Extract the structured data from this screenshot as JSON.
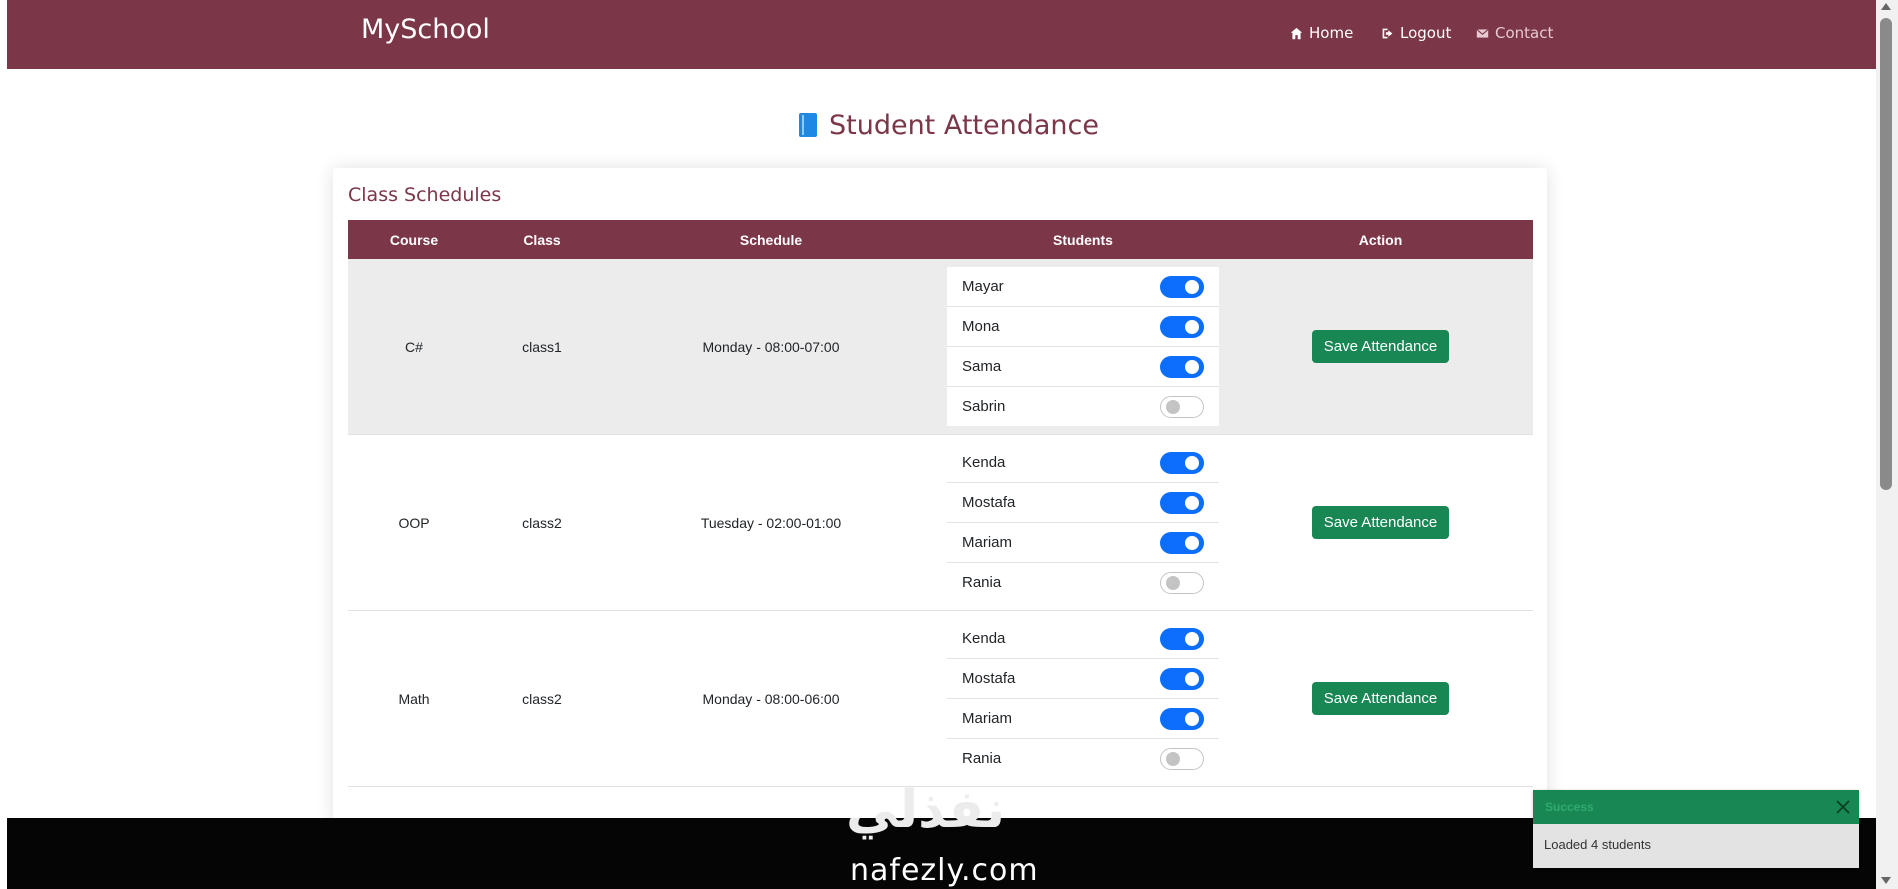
{
  "navbar": {
    "brand": "MySchool",
    "links": [
      {
        "label": "Home",
        "icon": "home-icon"
      },
      {
        "label": "Logout",
        "icon": "logout-icon"
      },
      {
        "label": "Contact",
        "icon": "mail-icon"
      }
    ],
    "color": "#7b3648"
  },
  "page": {
    "title": "Student Attendance",
    "title_icon": "book-icon"
  },
  "card": {
    "title": "Class Schedules",
    "columns": [
      "Course",
      "Class",
      "Schedule",
      "Students",
      "Action"
    ],
    "rows": [
      {
        "course": "C#",
        "class": "class1",
        "schedule": "Monday - 08:00-07:00",
        "students": [
          {
            "name": "Mayar",
            "present": true
          },
          {
            "name": "Mona",
            "present": true
          },
          {
            "name": "Sama",
            "present": true
          },
          {
            "name": "Sabrin",
            "present": false
          }
        ],
        "action": "Save Attendance"
      },
      {
        "course": "OOP",
        "class": "class2",
        "schedule": "Tuesday - 02:00-01:00",
        "students": [
          {
            "name": "Kenda",
            "present": true
          },
          {
            "name": "Mostafa",
            "present": true
          },
          {
            "name": "Mariam",
            "present": true
          },
          {
            "name": "Rania",
            "present": false
          }
        ],
        "action": "Save Attendance"
      },
      {
        "course": "Math",
        "class": "class2",
        "schedule": "Monday - 08:00-06:00",
        "students": [
          {
            "name": "Kenda",
            "present": true
          },
          {
            "name": "Mostafa",
            "present": true
          },
          {
            "name": "Mariam",
            "present": true
          },
          {
            "name": "Rania",
            "present": false
          }
        ],
        "action": "Save Attendance"
      }
    ]
  },
  "toast": {
    "title": "Success",
    "message": "Loaded 4 students",
    "color": "#198754"
  },
  "watermark": {
    "arabic": "نفذلي",
    "latin": "nafezly.com"
  },
  "colors": {
    "toggle_on": "#0d6efd",
    "button": "#198754"
  }
}
